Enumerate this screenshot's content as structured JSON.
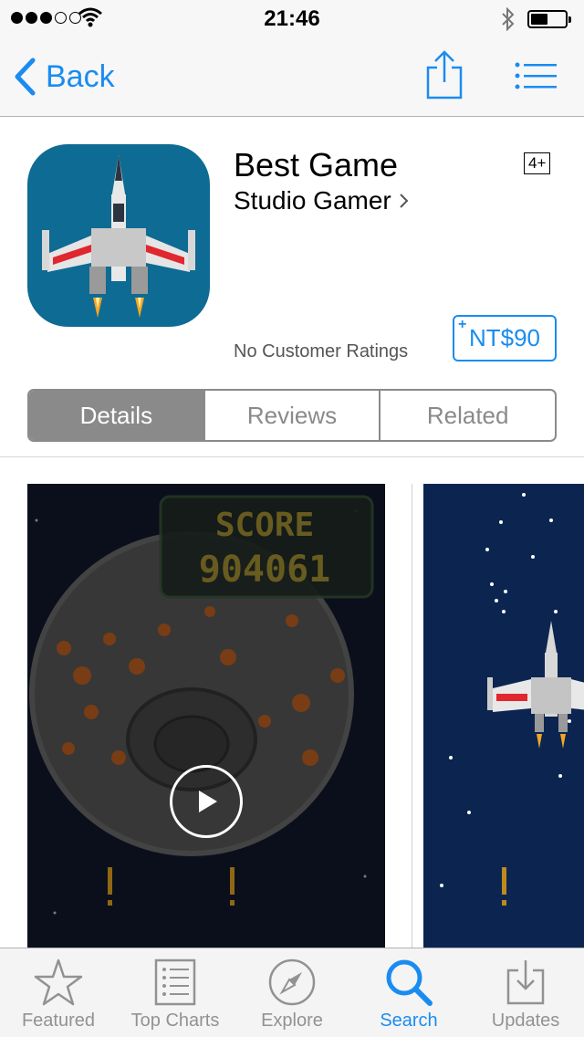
{
  "status_bar": {
    "time": "21:46",
    "signal_icon": "signal-dots-icon",
    "wifi_icon": "wifi-icon",
    "bluetooth_icon": "bluetooth-icon",
    "battery_icon": "battery-icon"
  },
  "nav": {
    "back_label": "Back",
    "share_icon": "share-icon",
    "menu_icon": "list-menu-icon"
  },
  "app": {
    "title": "Best Game",
    "developer": "Studio Gamer",
    "age_rating": "4+",
    "ratings_text": "No Customer Ratings",
    "price": "NT$90",
    "price_plus": "+",
    "icon": "spaceship-app-icon"
  },
  "tabs": [
    {
      "label": "Details",
      "active": true
    },
    {
      "label": "Reviews",
      "active": false
    },
    {
      "label": "Related",
      "active": false
    }
  ],
  "screenshots": {
    "score_label": "SCORE",
    "score_value": "904061",
    "play_icon": "play-icon"
  },
  "tab_bar": [
    {
      "label": "Featured",
      "icon": "star-icon"
    },
    {
      "label": "Top Charts",
      "icon": "top-charts-icon"
    },
    {
      "label": "Explore",
      "icon": "compass-icon"
    },
    {
      "label": "Search",
      "icon": "search-icon",
      "active": true
    },
    {
      "label": "Updates",
      "icon": "download-tray-icon"
    }
  ],
  "colors": {
    "accent": "#1a8cf0",
    "segment_gray": "#8a8a8a",
    "app_icon_bg": "#0e6b93"
  }
}
